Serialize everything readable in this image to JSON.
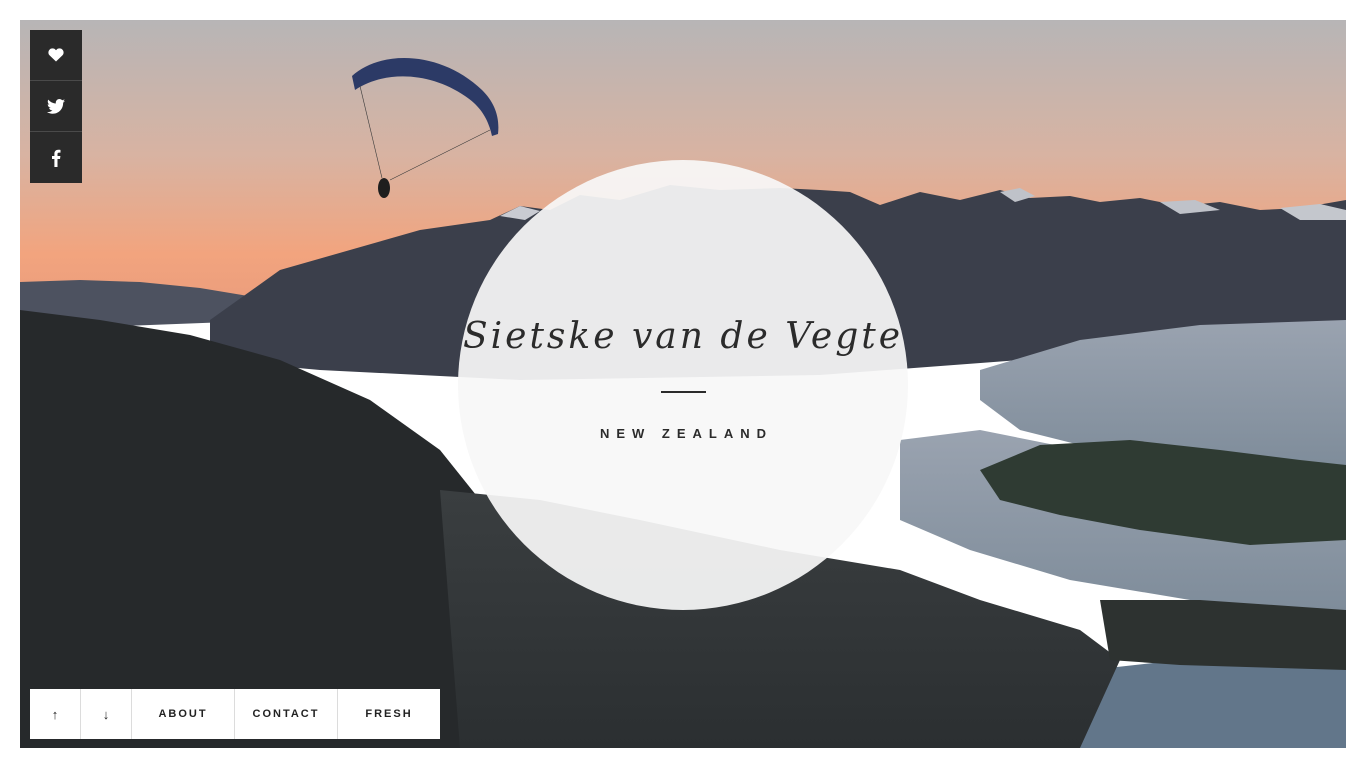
{
  "hero": {
    "title": "Sietske van de Vegte",
    "subtitle": "NEW ZEALAND",
    "background": "aerial-photo-paraglider-over-lake-town-at-dusk"
  },
  "social": [
    {
      "icon": "heart-icon"
    },
    {
      "icon": "twitter-icon"
    },
    {
      "icon": "facebook-icon"
    }
  ],
  "nav": {
    "up": "↑",
    "down": "↓",
    "about": "ABOUT",
    "contact": "CONTACT",
    "fresh": "FRESH"
  },
  "colors": {
    "sky_top": "#b9b4b2",
    "sky_horizon": "#f0a27c",
    "mountains": "#3a3f4c",
    "lake": "#8d9aa9",
    "foreground": "#25282b",
    "circle": "#f7f7f8",
    "social_bg": "#2a2a2a",
    "nav_bg": "#ffffff",
    "text": "#2b2b2b"
  }
}
